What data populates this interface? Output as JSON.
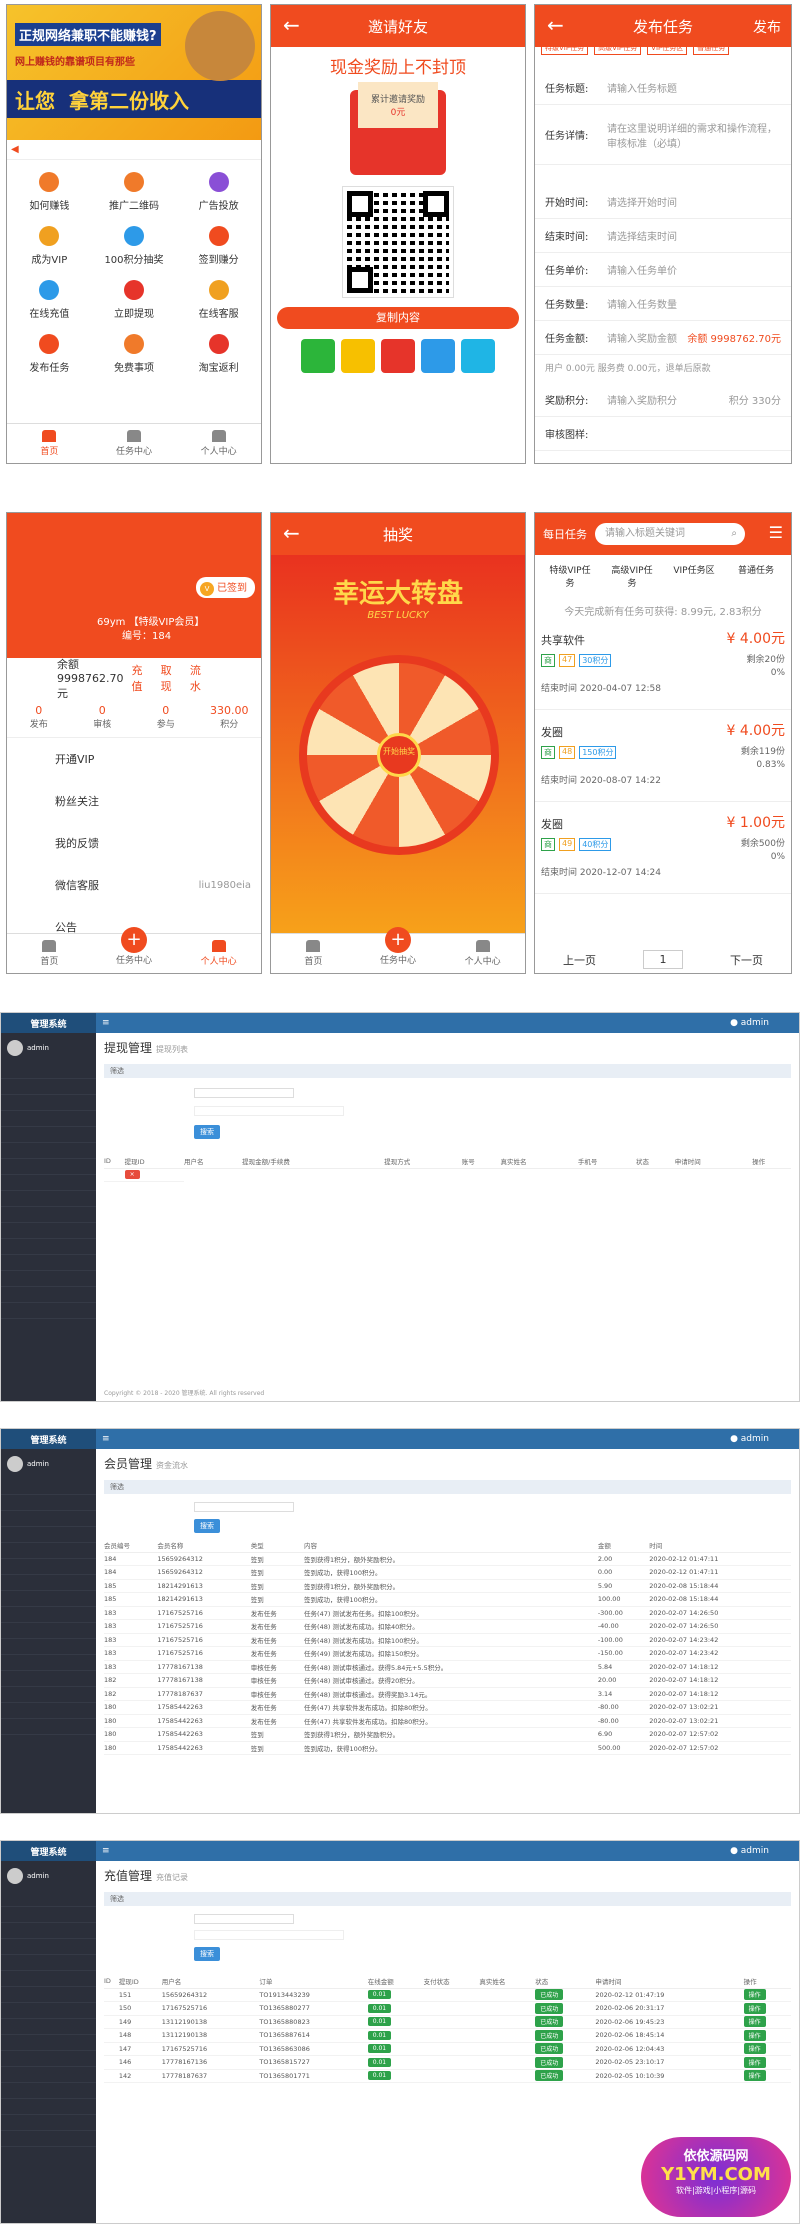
{
  "p1": {
    "banner_line1": "正规网络兼职不能赚钱?",
    "banner_line2": "网上赚钱的靠谱项目有那些",
    "banner_line3": "让您",
    "banner_line4": "拿第二份收入",
    "grid": [
      "如何赚钱",
      "推广二维码",
      "广告投放",
      "成为VIP",
      "100积分抽奖",
      "签到赚分",
      "在线充值",
      "立即提现",
      "在线客服",
      "发布任务",
      "免费事项",
      "淘宝返利"
    ],
    "tabs": [
      "首页",
      "任务中心",
      "个人中心"
    ]
  },
  "p2": {
    "title": "邀请好友",
    "slogan": "现金奖励上不封顶",
    "env_label": "累计邀请奖励",
    "env_value": "0元",
    "copy_btn": "复制内容"
  },
  "p3": {
    "title": "发布任务",
    "right": "发布",
    "chips": [
      "特级VIP任务",
      "高级VIP任务",
      "VIP任务区",
      "普通任务"
    ],
    "fields": [
      {
        "k": "任务标题:",
        "v": "请输入任务标题"
      },
      {
        "k": "任务详情:",
        "v": "请在这里说明详细的需求和操作流程，审核标准（必填）"
      },
      {
        "k": "开始时间:",
        "v": "请选择开始时间"
      },
      {
        "k": "结束时间:",
        "v": "请选择结束时间"
      },
      {
        "k": "任务单价:",
        "v": "请输入任务单价"
      },
      {
        "k": "任务数量:",
        "v": "请输入任务数量"
      },
      {
        "k": "任务金额:",
        "v": "请输入奖励金额"
      },
      {
        "k": "奖励积分:",
        "v": "请输入奖励积分"
      },
      {
        "k": "审核图样:",
        "v": ""
      }
    ],
    "balance": "余额 9998762.70元",
    "fee_text": "用户 0.00元 服务费 0.00元，退单后原款",
    "points": "积分 330分"
  },
  "p4": {
    "vip": "已签到",
    "name": "69ym 【特级VIP会员】",
    "id": "编号：184",
    "balance": "余额 9998762.70元",
    "links": [
      "充值",
      "取现",
      "流水"
    ],
    "stats": [
      {
        "n": "0",
        "l": "发布"
      },
      {
        "n": "0",
        "l": "审核"
      },
      {
        "n": "0",
        "l": "参与"
      },
      {
        "n": "330.00",
        "l": "积分"
      }
    ],
    "menu": [
      "开通VIP",
      "粉丝关注",
      "我的反馈",
      "微信客服",
      "公告"
    ],
    "wechat": "liu1980eia",
    "tabs": [
      "首页",
      "任务中心",
      "个人中心"
    ]
  },
  "p5": {
    "title": "抽奖",
    "wheel_title": "幸运大转盘",
    "wheel_sub": "BEST LUCKY",
    "center": "开始抽奖",
    "tabs": [
      "首页",
      "任务中心",
      "个人中心"
    ]
  },
  "p6": {
    "header": "每日任务",
    "search_placeholder": "请输入标题关键词",
    "cats": [
      "特级VIP任务",
      "高级VIP任务",
      "VIP任务区",
      "普通任务"
    ],
    "today": "今天完成新有任务可获得: 8.99元, 2.83积分",
    "tasks": [
      {
        "title": "共享软件",
        "tag": "47",
        "tag2": "30积分",
        "price": "¥ 4.00元",
        "left": "剩余20份",
        "pct": "0%",
        "end": "结束时间  2020-04-07 12:58"
      },
      {
        "title": "发圈",
        "tag": "48",
        "tag2": "150积分",
        "price": "¥ 4.00元",
        "left": "剩余119份",
        "pct": "0.83%",
        "end": "结束时间  2020-08-07 14:22"
      },
      {
        "title": "发圈",
        "tag": "49",
        "tag2": "40积分",
        "price": "¥ 1.00元",
        "left": "剩余500份",
        "pct": "0%",
        "end": "结束时间  2020-12-07 14:24"
      }
    ],
    "prev": "上一页",
    "next": "下一页",
    "page": "1"
  },
  "admin1": {
    "brand": "管理系统",
    "title": "提现管理",
    "subtitle": "提现列表",
    "bar": "筛选",
    "search_btn": "搜索",
    "cols": [
      "ID",
      "提现ID",
      "用户名",
      "提现金额/手续费",
      "提现方式",
      "账号",
      "真实姓名",
      "手机号",
      "状态",
      "申请时间",
      "操作"
    ],
    "footer": "Copyright © 2018 - 2020 管理系统. All rights reserved"
  },
  "admin2": {
    "brand": "管理系统",
    "title": "会员管理",
    "subtitle": "资金流水",
    "bar": "筛选",
    "search_btn": "搜索",
    "cols": [
      "会员编号",
      "会员名称",
      "类型",
      "内容",
      "金额",
      "时间"
    ],
    "rows": [
      [
        "184",
        "15659264312",
        "签到",
        "签到获得1积分，额外奖励积分。",
        "2.00",
        "2020-02-12 01:47:11"
      ],
      [
        "184",
        "15659264312",
        "签到",
        "签到成功，获得100积分。",
        "0.00",
        "2020-02-12 01:47:11"
      ],
      [
        "185",
        "18214291613",
        "签到",
        "签到获得1积分，额外奖励积分。",
        "5.90",
        "2020-02-08 15:18:44"
      ],
      [
        "185",
        "18214291613",
        "签到",
        "签到成功，获得100积分。",
        "100.00",
        "2020-02-08 15:18:44"
      ],
      [
        "183",
        "17167525716",
        "发布任务",
        "任务(47) 测试发布任务。扣除100积分。",
        "-300.00",
        "2020-02-07 14:26:50"
      ],
      [
        "183",
        "17167525716",
        "发布任务",
        "任务(48) 测试发布成功。扣除40积分。",
        "-40.00",
        "2020-02-07 14:26:50"
      ],
      [
        "183",
        "17167525716",
        "发布任务",
        "任务(48) 测试发布成功。扣除100积分。",
        "-100.00",
        "2020-02-07 14:23:42"
      ],
      [
        "183",
        "17167525716",
        "发布任务",
        "任务(49) 测试发布成功。扣除150积分。",
        "-150.00",
        "2020-02-07 14:23:42"
      ],
      [
        "183",
        "17778167138",
        "审核任务",
        "任务(48) 测试审核通过。获得5.84元+5.5积分。",
        "5.84",
        "2020-02-07 14:18:12"
      ],
      [
        "182",
        "17778167138",
        "审核任务",
        "任务(48) 测试审核通过。获得20积分。",
        "20.00",
        "2020-02-07 14:18:12"
      ],
      [
        "182",
        "17778187637",
        "审核任务",
        "任务(48) 测试审核通过。获得奖励3.14元。",
        "3.14",
        "2020-02-07 14:18:12"
      ],
      [
        "180",
        "17585442263",
        "发布任务",
        "任务(47) 共享软件发布成功。扣除80积分。",
        "-80.00",
        "2020-02-07 13:02:21"
      ],
      [
        "180",
        "17585442263",
        "发布任务",
        "任务(47) 共享软件发布成功。扣除80积分。",
        "-80.00",
        "2020-02-07 13:02:21"
      ],
      [
        "180",
        "17585442263",
        "签到",
        "签到获得1积分，额外奖励积分。",
        "6.90",
        "2020-02-07 12:57:02"
      ],
      [
        "180",
        "17585442263",
        "签到",
        "签到成功，获得100积分。",
        "500.00",
        "2020-02-07 12:57:02"
      ]
    ]
  },
  "admin3": {
    "brand": "管理系统",
    "title": "充值管理",
    "subtitle": "充值记录",
    "bar": "筛选",
    "search_btn": "搜索",
    "cols": [
      "ID",
      "提现ID",
      "用户名",
      "订单",
      "在线金额",
      "支付状态",
      "真实姓名",
      "状态",
      "申请时间",
      "操作"
    ],
    "rows": [
      [
        "151",
        "15659264312",
        "TO1913443239",
        "0.01",
        "2020-02-12 01:47:19"
      ],
      [
        "150",
        "17167525716",
        "TO1365880277",
        "0.01",
        "2020-02-06 20:31:17"
      ],
      [
        "149",
        "13112190138",
        "TO1365880823",
        "0.01",
        "2020-02-06 19:45:23"
      ],
      [
        "148",
        "13112190138",
        "TO1365887614",
        "0.01",
        "2020-02-06 18:45:14"
      ],
      [
        "147",
        "17167525716",
        "TO1365863086",
        "0.01",
        "2020-02-06 12:04:43"
      ],
      [
        "146",
        "17778167136",
        "TO1365815727",
        "0.01",
        "2020-02-05 23:10:17"
      ],
      [
        "142",
        "17778187637",
        "TO1365801771",
        "0.01",
        "2020-02-05 10:10:39"
      ]
    ],
    "status": "已成功",
    "op": "操作"
  },
  "watermark": {
    "line1": "依依源码网",
    "line2": "Y1YM.COM",
    "line3": "软件|游戏|小程序|源码"
  },
  "colors": {
    "accent": "#f04b1f",
    "admin_blue": "#2f6fa8",
    "sidebar": "#2b2f3a"
  }
}
